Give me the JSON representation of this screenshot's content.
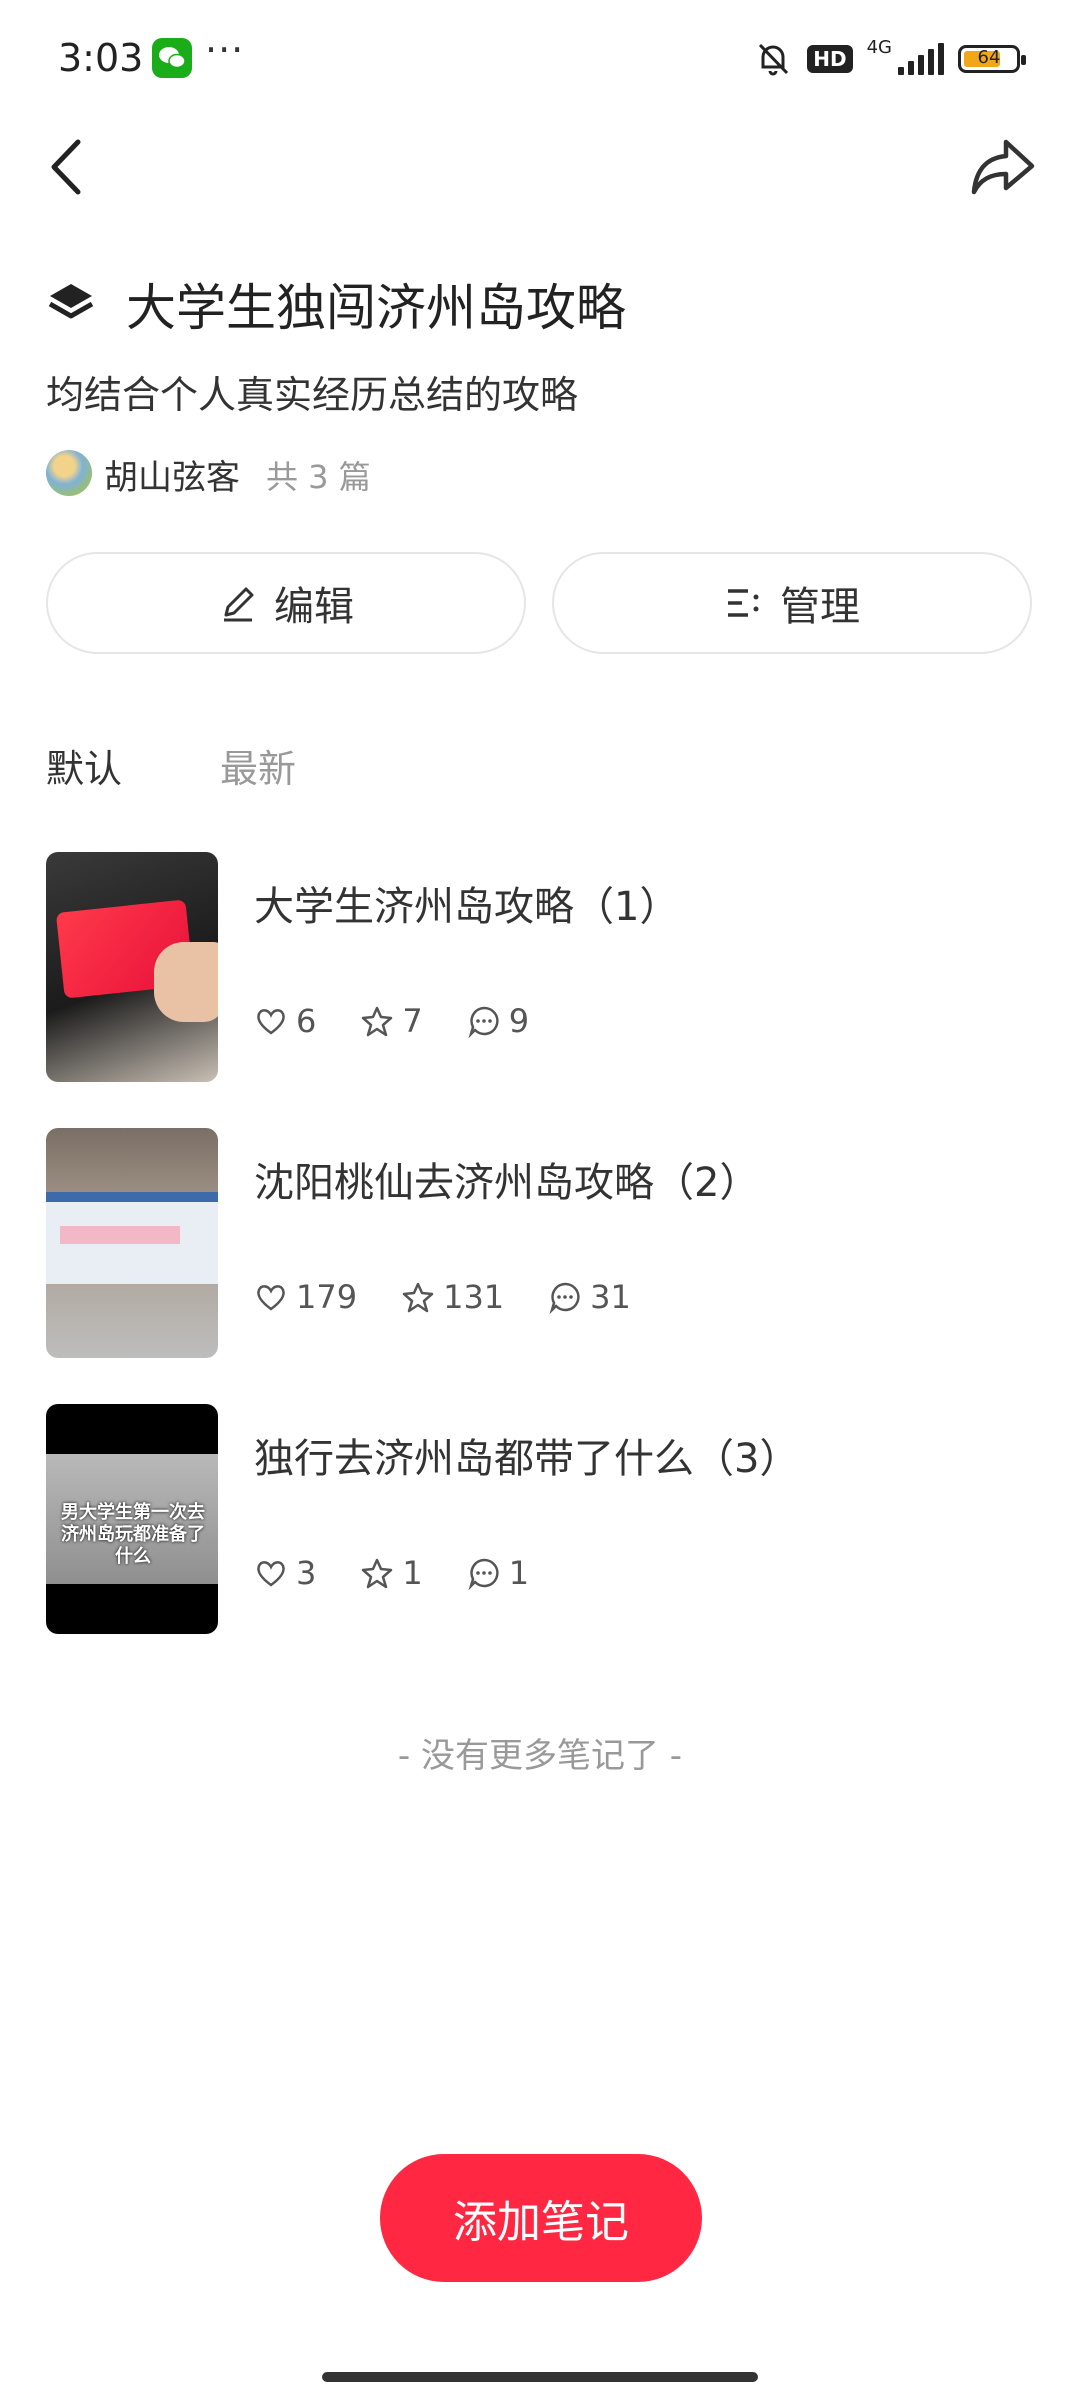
{
  "status_bar": {
    "time": "3:03",
    "dots": "···",
    "hd": "HD",
    "network": "4G",
    "battery": "64"
  },
  "header": {
    "title": "大学生独闯济州岛攻略",
    "description": "均结合个人真实经历总结的攻略",
    "author": "胡山弦客",
    "count": "共 3 篇"
  },
  "actions": {
    "edit_label": "编辑",
    "manage_label": "管理"
  },
  "tabs": [
    {
      "label": "默认",
      "active": true
    },
    {
      "label": "最新",
      "active": false
    }
  ],
  "notes": [
    {
      "title": "大学生济州岛攻略（1）",
      "likes": "6",
      "collects": "7",
      "comments": "9"
    },
    {
      "title": "沈阳桃仙去济州岛攻略（2）",
      "likes": "179",
      "collects": "131",
      "comments": "31"
    },
    {
      "title": "独行去济州岛都带了什么（3）",
      "likes": "3",
      "collects": "1",
      "comments": "1",
      "thumb_text": "男大学生第一次去济州岛玩都准备了什么"
    }
  ],
  "footer": {
    "end_text": "- 没有更多笔记了 -",
    "add_button": "添加笔记"
  },
  "colors": {
    "accent": "#ff2741",
    "wechat": "#1aad19",
    "battery": "#f2a71b"
  }
}
